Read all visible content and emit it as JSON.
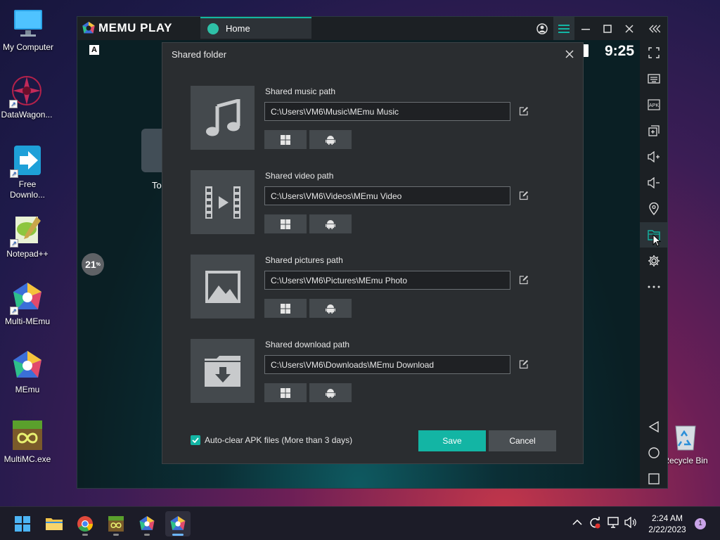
{
  "desktop": {
    "icons": [
      {
        "label": "My Computer"
      },
      {
        "label": "DataWagon..."
      },
      {
        "label": "Free\nDownlo..."
      },
      {
        "label": "Notepad++"
      },
      {
        "label": "Multi-MEmu"
      },
      {
        "label": "MEmu"
      },
      {
        "label": "MultiMC.exe"
      },
      {
        "label": "Recycle Bin"
      }
    ]
  },
  "memu": {
    "logo": "MEMU PLAY",
    "tab_home": "Home",
    "time": "9:25",
    "progress_value": "21",
    "progress_unit": "%",
    "folder_widget_label": "To"
  },
  "dialog": {
    "title": "Shared folder",
    "rows": [
      {
        "label": "Shared music path",
        "path": "C:\\Users\\VM6\\Music\\MEmu Music",
        "icon": "music-note-icon"
      },
      {
        "label": "Shared video path",
        "path": "C:\\Users\\VM6\\Videos\\MEmu Video",
        "icon": "film-icon"
      },
      {
        "label": "Shared pictures path",
        "path": "C:\\Users\\VM6\\Pictures\\MEmu Photo",
        "icon": "picture-icon"
      },
      {
        "label": "Shared download path",
        "path": "C:\\Users\\VM6\\Downloads\\MEmu Download",
        "icon": "download-folder-icon"
      }
    ],
    "auto_clear_label": "Auto-clear APK files (More than 3 days)",
    "auto_clear_checked": true,
    "save_label": "Save",
    "cancel_label": "Cancel"
  },
  "taskbar": {
    "time": "2:24 AM",
    "date": "2/22/2023",
    "notification_count": "1"
  },
  "colors": {
    "accent": "#13b5a4",
    "dialog_bg": "#2a2d30",
    "thumb_bg": "#44494d"
  }
}
